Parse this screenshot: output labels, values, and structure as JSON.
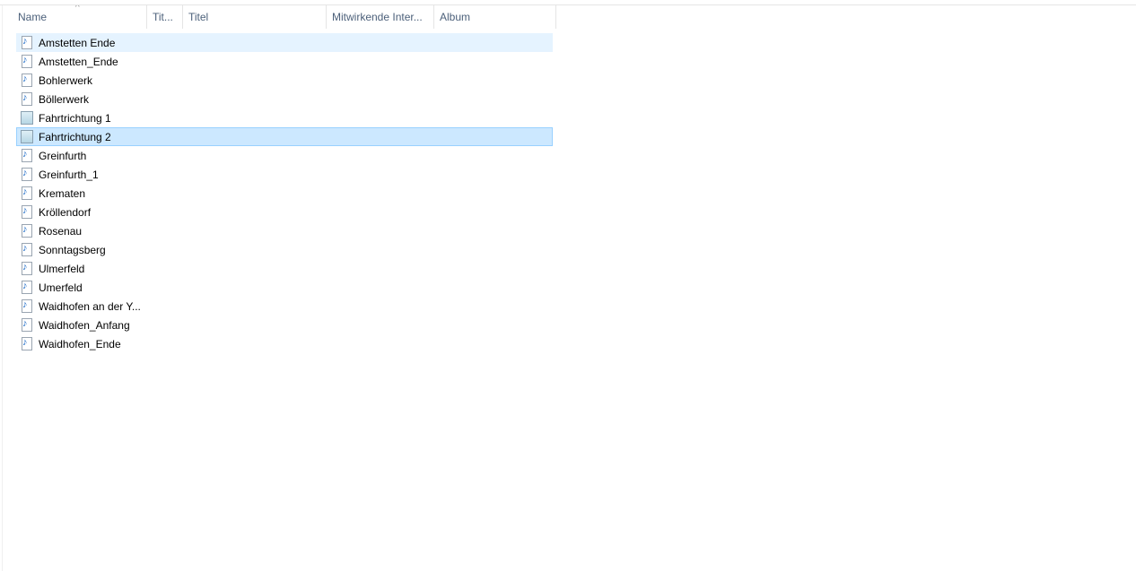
{
  "columns": [
    {
      "label": "Name"
    },
    {
      "label": "Tit..."
    },
    {
      "label": "Titel"
    },
    {
      "label": "Mitwirkende Inter..."
    },
    {
      "label": "Album"
    }
  ],
  "sort_indicator": "^",
  "files": [
    {
      "name": "Amstetten Ende",
      "icon": "audio-file-icon",
      "state": "hover"
    },
    {
      "name": "Amstetten_Ende",
      "icon": "audio-file-icon"
    },
    {
      "name": "Bohlerwerk",
      "icon": "audio-file-icon"
    },
    {
      "name": "Böllerwerk",
      "icon": "audio-file-icon"
    },
    {
      "name": "Fahrtrichtung 1",
      "icon": "text-document-icon"
    },
    {
      "name": "Fahrtrichtung 2",
      "icon": "text-document-icon",
      "state": "selected"
    },
    {
      "name": "Greinfurth",
      "icon": "audio-file-icon"
    },
    {
      "name": "Greinfurth_1",
      "icon": "audio-file-icon"
    },
    {
      "name": "Krematen",
      "icon": "audio-file-icon"
    },
    {
      "name": "Kröllendorf",
      "icon": "audio-file-icon"
    },
    {
      "name": "Rosenau",
      "icon": "audio-file-icon"
    },
    {
      "name": "Sonntagsberg",
      "icon": "audio-file-icon"
    },
    {
      "name": "Ulmerfeld",
      "icon": "audio-file-icon"
    },
    {
      "name": "Umerfeld",
      "icon": "audio-file-icon"
    },
    {
      "name": "Waidhofen an der Y...",
      "icon": "audio-file-icon"
    },
    {
      "name": "Waidhofen_Anfang",
      "icon": "audio-file-icon"
    },
    {
      "name": "Waidhofen_Ende",
      "icon": "audio-file-icon"
    }
  ],
  "colors": {
    "hover": "#e5f3ff",
    "selected": "#cce8ff",
    "selected_border": "#99d1ff",
    "header_text": "#4c607a"
  }
}
